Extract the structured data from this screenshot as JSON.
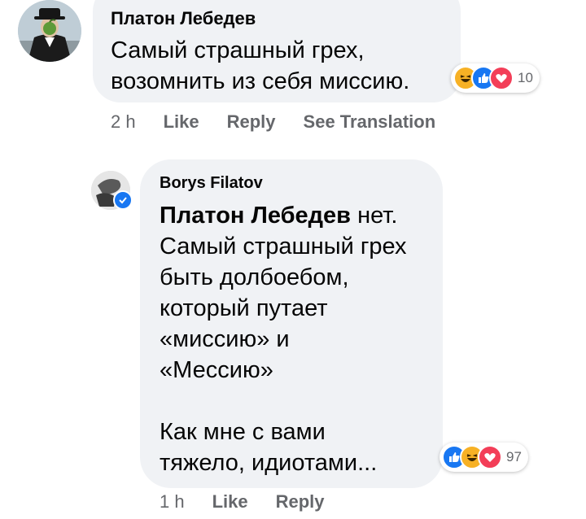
{
  "comment": {
    "author": "Платон Лебедев",
    "text": "Самый страшный грех,\nвозомнить из себя миссию.",
    "reactions": {
      "icons": [
        "haha-icon",
        "like-icon",
        "love-icon"
      ],
      "count": "10"
    },
    "time": "2 h",
    "like_label": "Like",
    "reply_label": "Reply",
    "translate_label": "See Translation"
  },
  "reply": {
    "author": "Borys Filatov",
    "mention": "Платон Лебедев",
    "text": " нет.\nСамый страшный грех\nбыть долбоебом,\nкоторый путает\n«миссию» и\n«Мессию»\n\nКак мне с вами\nтяжело, идиотами...",
    "reactions": {
      "icons": [
        "like-icon",
        "haha-icon",
        "love-icon"
      ],
      "count": "97"
    },
    "time": "1 h",
    "like_label": "Like",
    "reply_label": "Reply"
  },
  "colors": {
    "bubble": "#f0f2f5",
    "meta": "#65676b",
    "like": "#1877f2",
    "love": "#f33e58",
    "haha": "#f7b125"
  }
}
